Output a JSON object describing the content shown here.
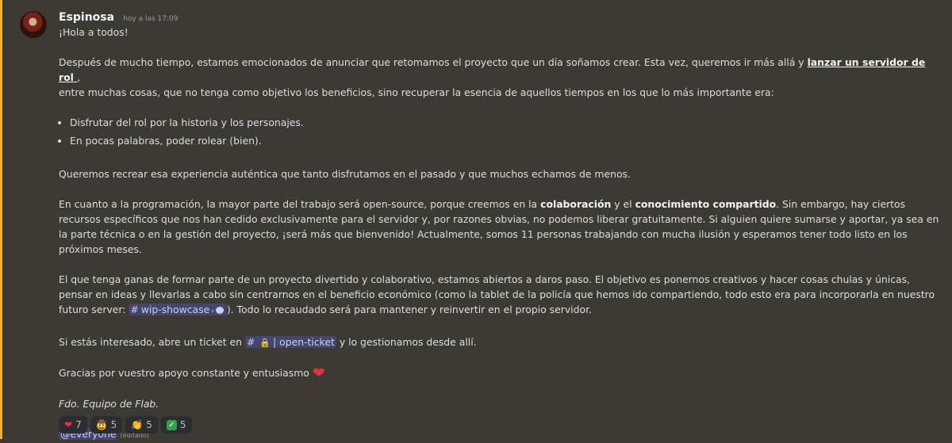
{
  "message": {
    "author": "Espinosa",
    "timestamp": "hoy a las 17:09",
    "greeting": "¡Hola a todos!",
    "p1_a": "Después de mucho tiempo, estamos emocionados de anunciar que retomamos el proyecto que un día soñamos crear. Esta vez, queremos ir más allá y ",
    "p1_link": "lanzar un servidor de rol ",
    "p1_b": ",",
    "p1_c": "entre muchas cosas, que no tenga como objetivo los beneficios, sino recuperar la esencia de aquellos tiempos en los que lo más importante era:",
    "bullets": [
      "Disfrutar del rol por la historia y los personajes.",
      "En pocas palabras, poder rolear (bien)."
    ],
    "p2": "Queremos recrear esa experiencia auténtica que tanto disfrutamos en el pasado y que muchos echamos de menos.",
    "p3_a": "En cuanto a la programación, la mayor parte del trabajo será open-source, porque creemos en la ",
    "p3_b1": "colaboración",
    "p3_c": " y el ",
    "p3_b2": "conocimiento compartido",
    "p3_d": ". Sin embargo, hay ciertos recursos específicos que nos han cedido exclusivamente para el servidor y, por razones obvias, no podemos liberar gratuitamente. Si alguien quiere sumarse y aportar, ya sea en la parte técnica o en la gestión del proyecto, ¡será más que bienvenido! Actualmente, somos 11 personas trabajando con mucha ilusión y esperamos tener todo listo en los próximos meses.",
    "p4_a": "El que tenga ganas de formar parte de un proyecto divertido y colaborativo, estamos abiertos a daros paso. El objetivo es ponernos creativos y hacer cosas chulas y únicas, pensar en ideas y llevarlas a cabo sin centrarnos en el beneficio económico (como la tablet de la policía que hemos ido compartiendo, todo esto era para incorporarla en nuestro futuro server:",
    "p4_channel": "wip-showcase",
    "p4_b": "). Todo lo recaudado será para mantener y reinvertir en el propio servidor.",
    "p5_a": "Si estás interesado, abre un ticket en ",
    "p5_channel": "| open-ticket",
    "p5_b": " y lo gestionamos desde allí.",
    "p6": "Gracias por vuestro apoyo constante y entusiasmo ",
    "signature": "Fdo. Equipo de Flab.",
    "mention": "@everyone",
    "edited": "(editado)",
    "channel_symbol": "#",
    "heart_glyph": "❤",
    "lock_glyph": "🔒"
  },
  "reactions": [
    {
      "emoji": "❤",
      "count": "7"
    },
    {
      "emoji": "🤠",
      "count": "5"
    },
    {
      "emoji": "👏",
      "count": "5"
    },
    {
      "emoji": "✓",
      "count": "5"
    }
  ],
  "colors": {
    "background": "#3d3a33",
    "highlight": "#f0b232",
    "mention_bg": "#5865f24d",
    "heart": "#e83040"
  }
}
